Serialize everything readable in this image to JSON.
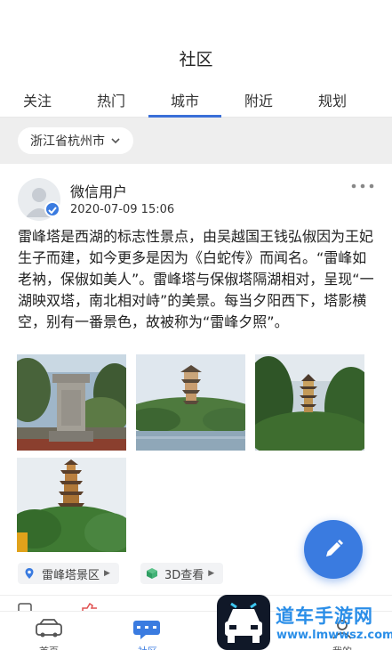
{
  "header": {
    "title": "社区"
  },
  "tabs": [
    {
      "label": "关注"
    },
    {
      "label": "热门"
    },
    {
      "label": "城市",
      "active": true
    },
    {
      "label": "附近"
    },
    {
      "label": "规划"
    }
  ],
  "filter": {
    "city": "浙江省杭州市"
  },
  "post": {
    "username": "微信用户",
    "timestamp": "2020-07-09 15:06",
    "body": "雷峰塔是西湖的标志性景点，由吴越国王钱弘俶因为王妃生子而建，如今更多是因为《白蛇传》而闻名。“雷峰如老衲，保俶如美人”。雷峰塔与保俶塔隔湖相对，呈现“一湖映双塔，南北相对峙”的美景。每当夕阳西下，塔影横空，别有一番景色，故被称为“雷峰夕照”。",
    "tags": [
      {
        "label": "雷峰塔景区",
        "icon": "location-pin-icon"
      },
      {
        "label": "3D查看",
        "icon": "cube-icon"
      }
    ],
    "photos": [
      {
        "subject": "stone-stele"
      },
      {
        "subject": "pagoda-by-lake"
      },
      {
        "subject": "pagoda-in-trees"
      },
      {
        "subject": "pagoda-on-hill"
      }
    ]
  },
  "fab": {
    "icon": "pencil-icon"
  },
  "bottom_nav": {
    "items": [
      {
        "label": "首页",
        "icon": "car-icon"
      },
      {
        "label": "社区",
        "icon": "chat-bubble-icon",
        "active": true
      },
      {
        "label": "我的",
        "icon": "user-icon"
      }
    ]
  },
  "watermark": {
    "title": "道车手游网",
    "url": "www.lmwwsz.com"
  },
  "colors": {
    "accent": "#3a7be0",
    "tab_active": "#3a6fd8",
    "watermark": "#2a8ee8"
  }
}
